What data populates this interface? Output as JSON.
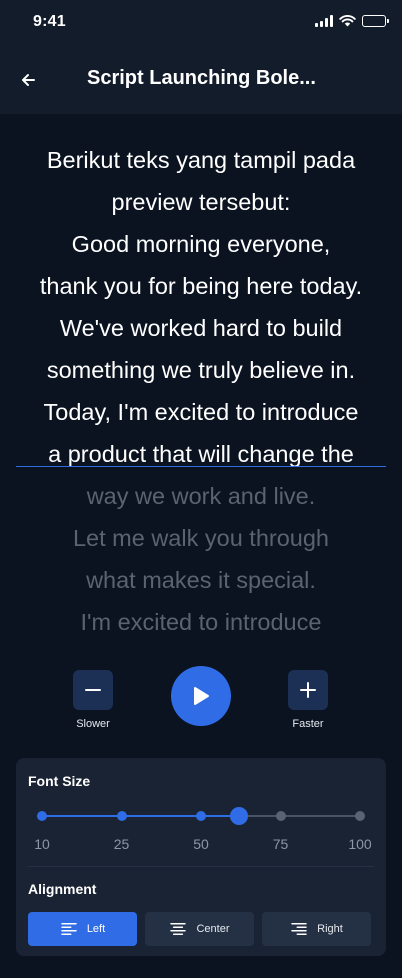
{
  "status_bar": {
    "time": "9:41",
    "icons": [
      "signal-icon",
      "wifi-icon",
      "battery-icon"
    ]
  },
  "header": {
    "back_icon": "arrow-left-icon",
    "title": "Script Launching Bole..."
  },
  "script": {
    "lines": [
      {
        "text": "Berikut teks yang tampil pada",
        "state": "read"
      },
      {
        "text": "preview tersebut:",
        "state": "read"
      },
      {
        "text": "Good morning everyone,",
        "state": "read"
      },
      {
        "text": "thank you for being here today.",
        "state": "read"
      },
      {
        "text": "We've worked hard to build",
        "state": "read"
      },
      {
        "text": "something we truly believe in.",
        "state": "read"
      },
      {
        "text": "Today, I'm excited to introduce",
        "state": "read"
      },
      {
        "text": "a product that will change the",
        "state": "current"
      },
      {
        "text": "way we work and live.",
        "state": "upcoming"
      },
      {
        "text": "Let me walk you through",
        "state": "upcoming"
      },
      {
        "text": "what makes it special.",
        "state": "upcoming"
      },
      {
        "text": "I'm excited to introduce",
        "state": "upcoming"
      }
    ]
  },
  "controls": {
    "slower": {
      "label": "Slower",
      "icon": "minus-icon"
    },
    "play": {
      "icon": "play-icon"
    },
    "faster": {
      "label": "Faster",
      "icon": "plus-icon"
    }
  },
  "settings": {
    "font_size": {
      "title": "Font Size",
      "ticks": [
        "10",
        "25",
        "50",
        "75",
        "100"
      ],
      "value_fraction": 0.62
    },
    "alignment": {
      "title": "Alignment",
      "options": [
        {
          "label": "Left",
          "icon": "align-left-icon",
          "active": true
        },
        {
          "label": "Center",
          "icon": "align-center-icon",
          "active": false
        },
        {
          "label": "Right",
          "icon": "align-right-icon",
          "active": false
        }
      ]
    }
  },
  "colors": {
    "background": "#0b1220",
    "bar": "#131c2b",
    "accent": "#2f6ce5",
    "panel": "#1a2333",
    "dim_text": "#5a6372"
  }
}
